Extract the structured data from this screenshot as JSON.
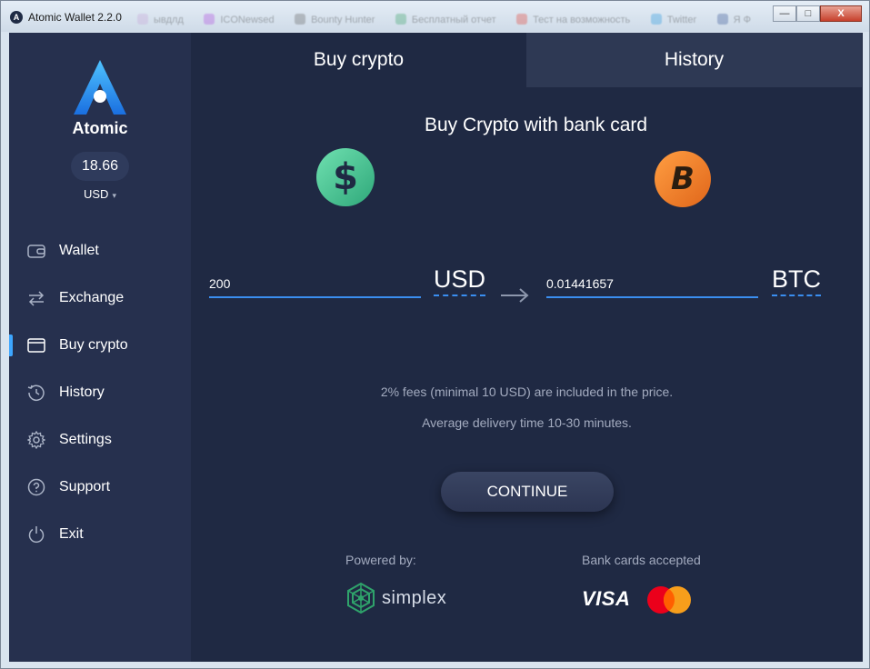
{
  "window": {
    "title": "Atomic Wallet 2.2.0",
    "app_icon_letter": "A",
    "background_tabs": [
      {
        "label": "ывдлд",
        "color": "#c7a7d9"
      },
      {
        "label": "ICONewsed",
        "color": "#b14fe0"
      },
      {
        "label": "Bounty Hunter",
        "color": "#666666"
      },
      {
        "label": "Бесплатный отчет",
        "color": "#3fa56c"
      },
      {
        "label": "Тест на возможность",
        "color": "#e2473b"
      },
      {
        "label": "Twitter",
        "color": "#2d9be0"
      },
      {
        "label": "Я Ф",
        "color": "#3b5998"
      }
    ],
    "minimize_label": "—",
    "maximize_label": "□",
    "close_label": "X"
  },
  "sidebar": {
    "brand": "Atomic",
    "balance": "18.66",
    "currency": "USD",
    "currency_caret": "▾",
    "items": [
      {
        "label": "Wallet",
        "icon": "wallet-icon",
        "active": false
      },
      {
        "label": "Exchange",
        "icon": "exchange-icon",
        "active": false
      },
      {
        "label": "Buy crypto",
        "icon": "card-icon",
        "active": true
      },
      {
        "label": "History",
        "icon": "history-icon",
        "active": false
      },
      {
        "label": "Settings",
        "icon": "gear-icon",
        "active": false
      },
      {
        "label": "Support",
        "icon": "help-icon",
        "active": false
      },
      {
        "label": "Exit",
        "icon": "power-icon",
        "active": false
      }
    ]
  },
  "tabs": [
    {
      "label": "Buy crypto",
      "active": true
    },
    {
      "label": "History",
      "active": false
    }
  ],
  "buy": {
    "heading": "Buy Crypto with bank card",
    "from_symbol": "$",
    "to_symbol": "B",
    "from_amount": "200",
    "from_currency": "USD",
    "to_amount": "0.01441657",
    "to_currency": "BTC",
    "fee_note": "2% fees (minimal 10 USD) are included in the price.",
    "delivery_note": "Average delivery time 10-30 minutes.",
    "continue_label": "CONTINUE",
    "powered_by_label": "Powered by:",
    "provider": "simplex",
    "cards_label": "Bank cards accepted",
    "visa": "VISA"
  },
  "colors": {
    "accent": "#3a8ef0",
    "background": "#1f2943",
    "sidebar": "#26304e",
    "usd_coin": "#3fc08e",
    "btc_coin": "#f7931a",
    "simplex_green": "#2fa36b",
    "mastercard_red": "#eb001b",
    "mastercard_orange": "#f79e1b"
  }
}
